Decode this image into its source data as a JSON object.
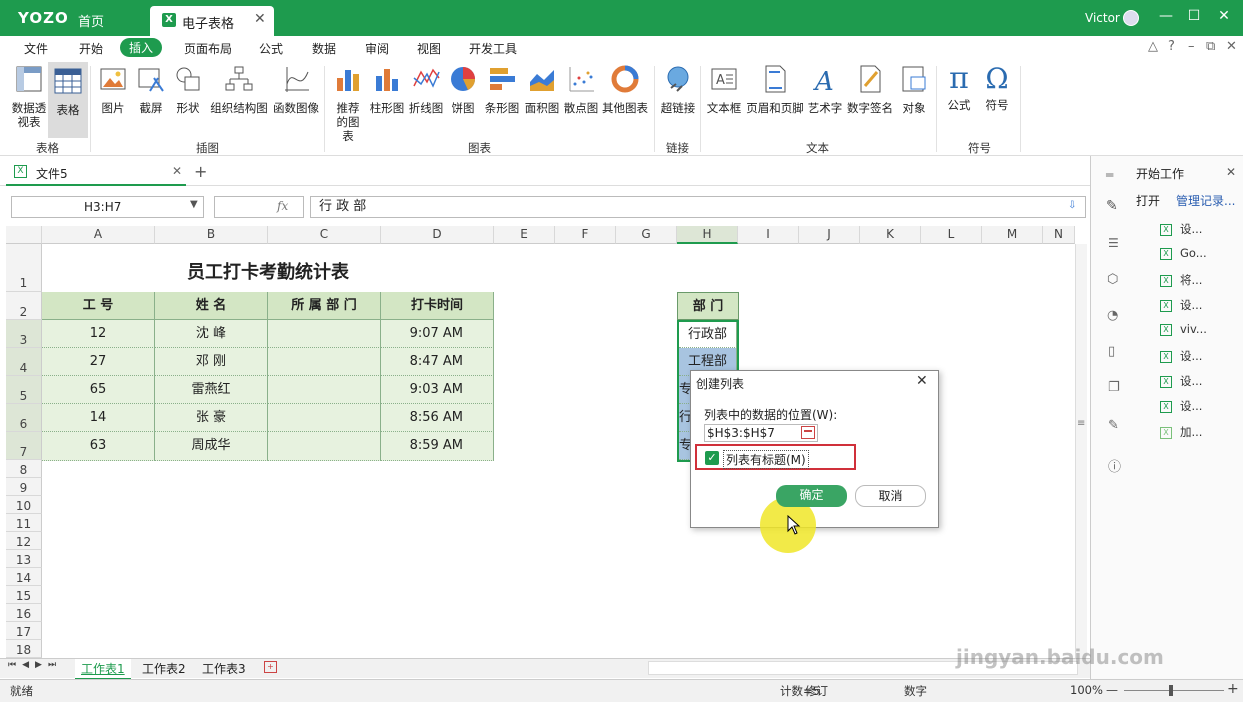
{
  "app": {
    "logo": "YOZO",
    "home_label": "首页",
    "doc_tab": "电子表格",
    "user": "Victor"
  },
  "menu": [
    "文件",
    "开始",
    "插入",
    "页面布局",
    "公式",
    "数据",
    "审阅",
    "视图",
    "开发工具"
  ],
  "ribbon": {
    "buttons": [
      "数据透视表",
      "表格",
      "图片",
      "截屏",
      "形状",
      "组织结构图",
      "函数图像",
      "推荐的图表",
      "柱形图",
      "折线图",
      "饼图",
      "条形图",
      "面积图",
      "散点图",
      "其他图表",
      "超链接",
      "文本框",
      "页眉和页脚",
      "艺术字",
      "数字签名",
      "对象",
      "公式",
      "符号"
    ],
    "groups": [
      "表格",
      "插图",
      "图表",
      "链接",
      "文本",
      "符号"
    ]
  },
  "file_tab": "文件5",
  "name_box": "H3:H7",
  "fx": "fx",
  "formula": "行 政 部",
  "columns": [
    "A",
    "B",
    "C",
    "D",
    "E",
    "F",
    "G",
    "H",
    "I",
    "J",
    "K",
    "L",
    "M",
    "N"
  ],
  "rows": [
    "1",
    "2",
    "3",
    "4",
    "5",
    "6",
    "7",
    "8",
    "9",
    "10",
    "11",
    "12",
    "13",
    "14",
    "15",
    "16",
    "17",
    "18"
  ],
  "sheet": {
    "title": "员工打卡考勤统计表",
    "headers": [
      "工 号",
      "姓 名",
      "所 属 部 门",
      "打卡时间"
    ],
    "data": [
      [
        "12",
        "沈 峰",
        "",
        "9:07 AM"
      ],
      [
        "27",
        "邓 刚",
        "",
        "8:47 AM"
      ],
      [
        "65",
        "雷燕红",
        "",
        "9:03 AM"
      ],
      [
        "14",
        "张 豪",
        "",
        "8:56 AM"
      ],
      [
        "63",
        "周成华",
        "",
        "8:59 AM"
      ]
    ],
    "h_header": "部 门",
    "h_values": [
      "行政部",
      "工程部",
      "专",
      "行",
      "专"
    ]
  },
  "dialog": {
    "title": "创建列表",
    "range_label": "列表中的数据的位置(W):",
    "range_value": "$H$3:$H$7",
    "checkbox_label": "列表有标题(M)",
    "ok": "确定",
    "cancel": "取消"
  },
  "sheet_tabs": [
    "工作表1",
    "工作表2",
    "工作表3"
  ],
  "status": {
    "ready": "就绪",
    "count": "计数=5",
    "rev": "修订",
    "num": "数字",
    "zoom": "100%"
  },
  "pane": {
    "title": "开始工作",
    "open": "打开",
    "manage": "管理记录...",
    "items": [
      "设...",
      "Go...",
      "将...",
      "设...",
      "viv...",
      "设...",
      "设...",
      "设...",
      "加..."
    ]
  },
  "watermark": "jingyan.baidu.com",
  "colors": {
    "brand": "#1e9b4e",
    "header_fill": "#d3e6c4",
    "cell_fill": "#e7f2df",
    "selection": "#a8c4e0"
  }
}
